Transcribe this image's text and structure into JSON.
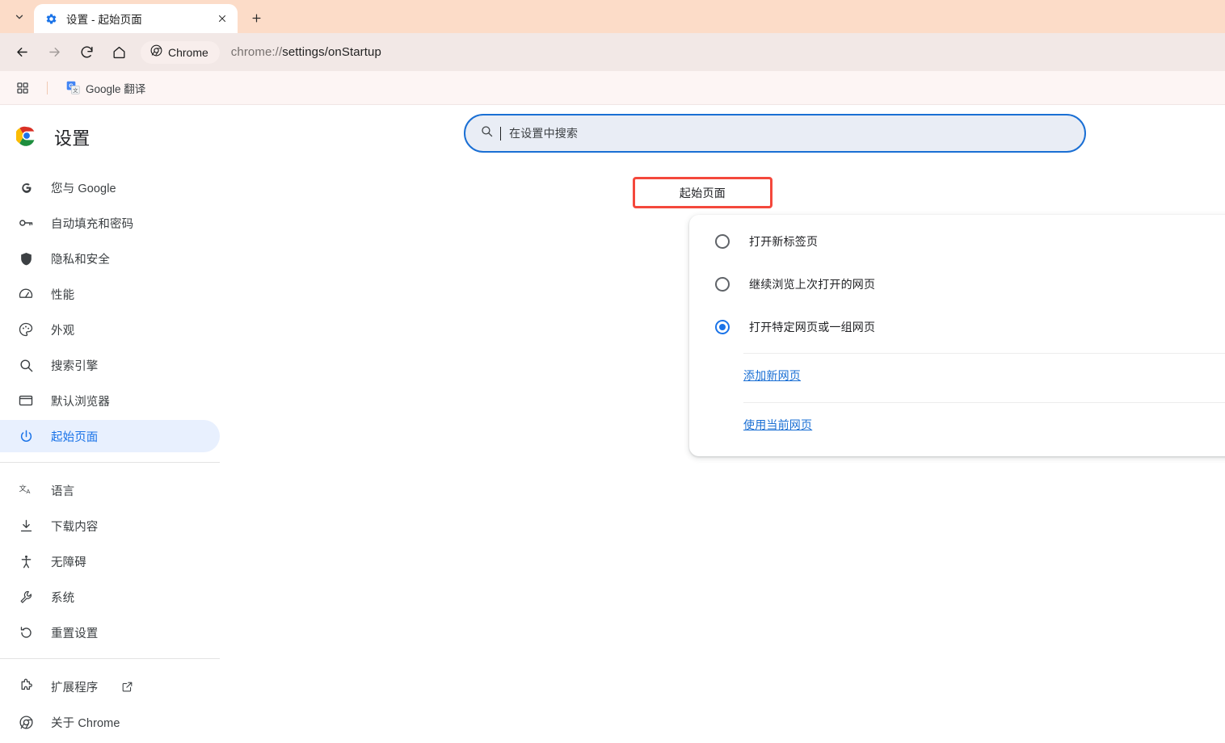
{
  "window": {
    "tab": {
      "title": "设置 - 起始页面",
      "favicon_icon": "gear-icon",
      "close_icon": "close-icon"
    },
    "tab_search_icon": "chevron-down-icon",
    "new_tab_icon": "plus-icon",
    "toolbar": {
      "back_icon": "back-arrow-icon",
      "forward_icon": "forward-arrow-icon",
      "reload_icon": "reload-icon",
      "home_icon": "home-icon",
      "chrome_chip_label": "Chrome",
      "chrome_chip_icon": "chrome-icon",
      "url_scheme": "chrome://",
      "url_path": "settings/onStartup"
    },
    "bookmarks": {
      "apps_icon": "apps-grid-icon",
      "items": [
        {
          "label": "Google 翻译",
          "icon": "google-translate-icon"
        }
      ]
    },
    "colors": {
      "tabstrip_bg": "#fcdcc8",
      "toolbar_bg": "#f2e8e6",
      "bookmarks_bg": "#fdf5f4",
      "accent_blue": "#1a73e8",
      "annotation_red": "#f4483c"
    }
  },
  "sidebar": {
    "brand_title": "设置",
    "brand_icon": "chrome-logo-icon",
    "items": [
      {
        "label": "您与 Google",
        "icon": "google-g-icon",
        "active": false
      },
      {
        "label": "自动填充和密码",
        "icon": "key-icon",
        "active": false
      },
      {
        "label": "隐私和安全",
        "icon": "shield-icon",
        "active": false
      },
      {
        "label": "性能",
        "icon": "speedometer-icon",
        "active": false
      },
      {
        "label": "外观",
        "icon": "palette-icon",
        "active": false
      },
      {
        "label": "搜索引擎",
        "icon": "search-icon",
        "active": false
      },
      {
        "label": "默认浏览器",
        "icon": "browser-window-icon",
        "active": false
      },
      {
        "label": "起始页面",
        "icon": "power-icon",
        "active": true
      }
    ],
    "items_group2": [
      {
        "label": "语言",
        "icon": "translate-icon"
      },
      {
        "label": "下载内容",
        "icon": "download-icon"
      },
      {
        "label": "无障碍",
        "icon": "accessibility-icon"
      },
      {
        "label": "系统",
        "icon": "wrench-icon"
      },
      {
        "label": "重置设置",
        "icon": "restore-icon"
      }
    ],
    "items_group3": [
      {
        "label": "扩展程序",
        "icon": "puzzle-piece-icon",
        "external": true,
        "external_icon": "open-in-new-icon"
      },
      {
        "label": "关于 Chrome",
        "icon": "chrome-mono-icon",
        "external": false
      }
    ]
  },
  "search": {
    "placeholder": "在设置中搜索",
    "value": "",
    "icon": "search-icon",
    "focused": true
  },
  "main": {
    "section_title": "起始页面",
    "startup_options": [
      {
        "label": "打开新标签页",
        "selected": false
      },
      {
        "label": "继续浏览上次打开的网页",
        "selected": false
      },
      {
        "label": "打开特定网页或一组网页",
        "selected": true
      }
    ],
    "links": [
      {
        "label": "添加新网页"
      },
      {
        "label": "使用当前网页"
      }
    ]
  }
}
